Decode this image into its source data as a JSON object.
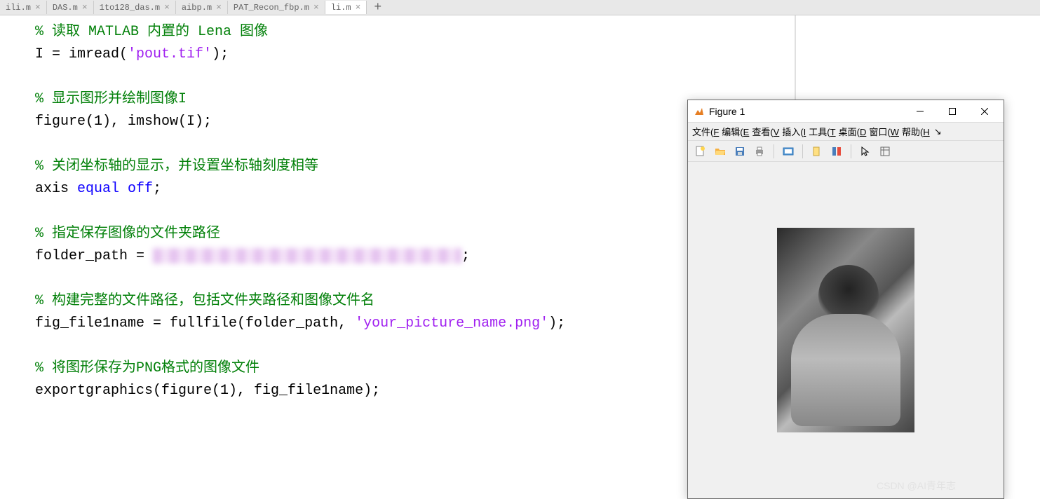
{
  "tabs": [
    {
      "label": "ili.m"
    },
    {
      "label": "DAS.m"
    },
    {
      "label": "1to128_das.m"
    },
    {
      "label": "aibp.m"
    },
    {
      "label": "PAT_Recon_fbp.m"
    },
    {
      "label": "li.m"
    }
  ],
  "code_lines": [
    {
      "type": "comment",
      "text": "% 读取 MATLAB 内置的 Lena 图像"
    },
    {
      "type": "code",
      "prefix": "I = imread(",
      "string": "'pout.tif'",
      "suffix": ");"
    },
    {
      "type": "blank",
      "text": ""
    },
    {
      "type": "comment",
      "text": "% 显示图形并绘制图像I"
    },
    {
      "type": "code",
      "prefix": "figure(1), imshow(I);",
      "string": "",
      "suffix": ""
    },
    {
      "type": "blank",
      "text": ""
    },
    {
      "type": "comment",
      "text": "% 关闭坐标轴的显示，并设置坐标轴刻度相等"
    },
    {
      "type": "axis",
      "prefix": "axis ",
      "kw1": "equal",
      "mid": " ",
      "kw2": "off",
      "suffix": ";"
    },
    {
      "type": "blank",
      "text": ""
    },
    {
      "type": "comment",
      "text": "% 指定保存图像的文件夹路径"
    },
    {
      "type": "redacted",
      "prefix": "folder_path = "
    },
    {
      "type": "blank",
      "text": ""
    },
    {
      "type": "comment",
      "text": "% 构建完整的文件路径，包括文件夹路径和图像文件名"
    },
    {
      "type": "code",
      "prefix": "fig_file1name = fullfile(folder_path, ",
      "string": "'your_picture_name.png'",
      "suffix": ");"
    },
    {
      "type": "blank",
      "text": ""
    },
    {
      "type": "comment",
      "text": "% 将图形保存为PNG格式的图像文件"
    },
    {
      "type": "code",
      "prefix": "exportgraphics(figure(1), fig_file1name);",
      "string": "",
      "suffix": ""
    }
  ],
  "figure": {
    "title": "Figure 1",
    "menus": [
      "文件(",
      "编辑(",
      "查看(",
      "插入(",
      "工具(",
      "桌面(",
      "窗口(",
      "帮助("
    ],
    "menu_shortcuts": [
      "F",
      "E",
      "V",
      "I",
      "T",
      "D",
      "W",
      "H"
    ]
  },
  "watermark": "CSDN @AI青年志"
}
